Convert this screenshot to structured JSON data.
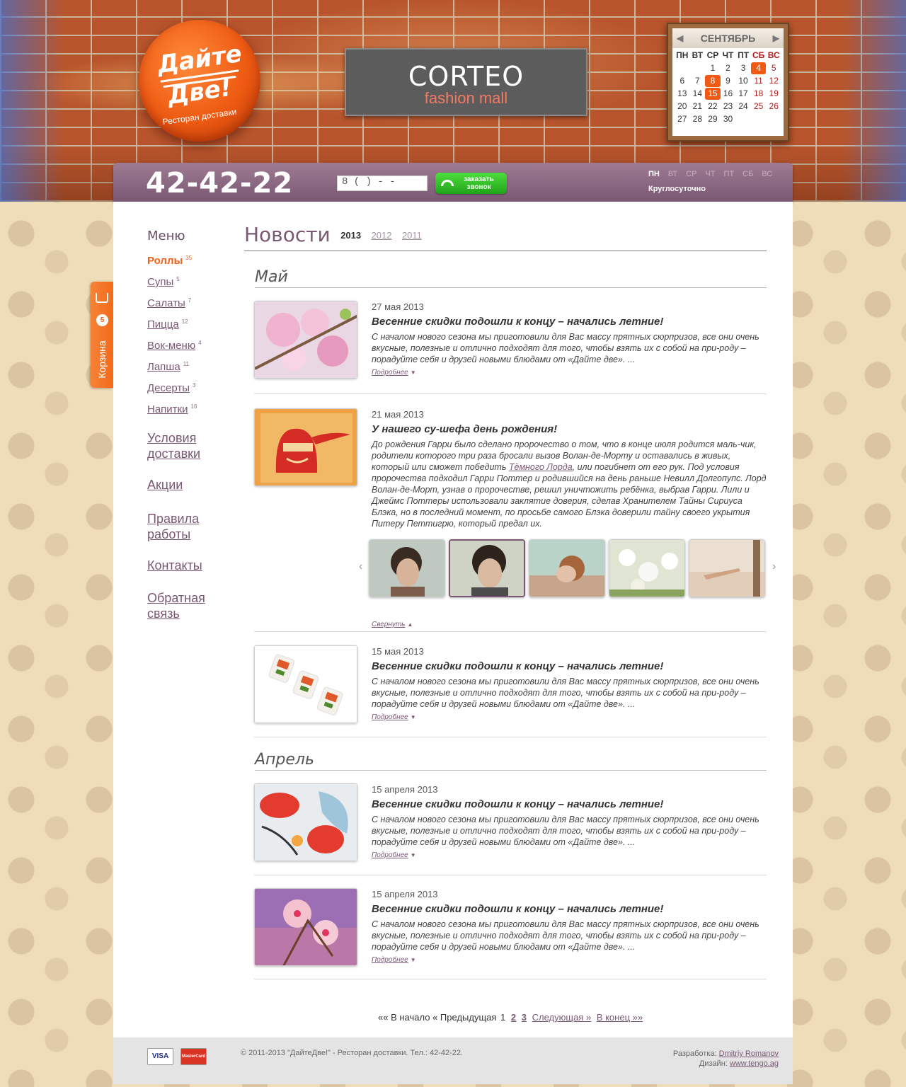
{
  "header": {
    "logo_line1": "Дайте",
    "logo_line2": "Две!",
    "logo_sub": "Ресторан доставки",
    "banner_title": "CORTEO",
    "banner_sub": "fashion mall",
    "calendar": {
      "month": "СЕНТЯБРЬ",
      "prev": "◀",
      "next": "▶",
      "day_names": [
        "ПН",
        "ВТ",
        "СР",
        "ЧТ",
        "ПТ",
        "СБ",
        "ВС"
      ],
      "weeks": [
        [
          "",
          "",
          "1",
          "2",
          "3",
          "4",
          "5"
        ],
        [
          "6",
          "7",
          "8",
          "9",
          "10",
          "11",
          "12"
        ],
        [
          "13",
          "14",
          "15",
          "16",
          "17",
          "18",
          "19"
        ],
        [
          "20",
          "21",
          "22",
          "23",
          "24",
          "25",
          "26"
        ],
        [
          "27",
          "28",
          "29",
          "30",
          "",
          "",
          ""
        ]
      ],
      "highlighted": [
        "4",
        "8",
        "15"
      ]
    }
  },
  "topbar": {
    "phone": "42-42-22",
    "phone_input_value": "8 (    )       -   -",
    "call_button": [
      "заказать",
      "звонок"
    ],
    "days": [
      "ПН",
      "ВТ",
      "СР",
      "ЧТ",
      "ПТ",
      "СБ",
      "ВС"
    ],
    "active_day": "ПН",
    "hours": "Круглосуточно"
  },
  "cart": {
    "label": "Корзина",
    "count": "5"
  },
  "menu": {
    "title": "Меню",
    "items": [
      {
        "label": "Роллы",
        "count": "35",
        "active": true
      },
      {
        "label": "Супы",
        "count": "5"
      },
      {
        "label": "Салаты",
        "count": "7"
      },
      {
        "label": "Пицца",
        "count": "12"
      },
      {
        "label": "Вок-меню",
        "count": "4"
      },
      {
        "label": "Лапша",
        "count": "11"
      },
      {
        "label": "Десерты",
        "count": "3"
      },
      {
        "label": "Напитки",
        "count": "16"
      }
    ],
    "links": [
      [
        "Условия",
        "доставки"
      ],
      [
        "Акции"
      ],
      [
        "Правила",
        "работы"
      ],
      [
        "Контакты"
      ],
      [
        "Обратная",
        "связь"
      ]
    ]
  },
  "news": {
    "title": "Новости",
    "years": [
      "2013",
      "2012",
      "2011"
    ],
    "months": [
      "Май",
      "Апрель"
    ],
    "items": [
      {
        "date": "27 мая 2013",
        "title": "Весенние скидки подошли к концу – начались летние!",
        "text": "С началом нового сезона мы приготовили для Вас массу прятных сюрпризов, все они очень вкусные, полезные и отлично подходят для того, чтобы взять их с собой на при-роду – порадуйте себя и друзей новыми блюдами от «Дайте две». ...",
        "more": "Подробнее"
      },
      {
        "date": "21 мая 2013",
        "title": "У нашего су-шефа день рождения!",
        "text_before": "До рождения Гарри было сделано пророчество о том, что в конце июля родится маль-чик, родители которого три раза бросали вызов Волан-де-Морту и оставались в живых, который или сможет победить ",
        "link": "Тёмного Лорда",
        "text_after": ", или погибнет от его рук. Под условия пророчества подходил Гарри Поттер и родившийся на день раньше Невилл Долгопупс. Лорд Волан-де-Морт, узнав о пророчестве, решил уничтожить ребёнка, выбрав Гарри. Лили и Джеймс Поттеры использовали заклятие доверия, сделав Хранителем Тайны Сириуса Блэка, но в последний момент, по просьбе самого Блэка доверили тайну своего укрытия Питеру Петтигрю, который предал их.",
        "collapse": "Свернуть"
      },
      {
        "date": "15 мая 2013",
        "title": "Весенние скидки подошли к концу – начались летние!",
        "text": "С началом нового сезона мы приготовили для Вас массу прятных сюрпризов, все они очень вкусные, полезные и отлично подходят для того, чтобы взять их с собой на при-роду – порадуйте себя и друзей новыми блюдами от «Дайте две». ...",
        "more": "Подробнее"
      },
      {
        "date": "15 апреля 2013",
        "title": "Весенние скидки подошли к концу – начались летние!",
        "text": "С началом нового сезона мы приготовили для Вас массу прятных сюрпризов, все они очень вкусные, полезные и отлично подходят для того, чтобы взять их с собой на при-роду – порадуйте себя и друзей новыми блюдами от «Дайте две». ...",
        "more": "Подробнее"
      },
      {
        "date": "15 апреля 2013",
        "title": "Весенние скидки подошли к концу – начались летние!",
        "text": "С началом нового сезона мы приготовили для Вас массу прятных сюрпризов, все они очень вкусные, полезные и отлично подходят для того, чтобы взять их с собой на при-роду – порадуйте себя и друзей новыми блюдами от «Дайте две». ...",
        "more": "Подробнее"
      }
    ]
  },
  "pager": {
    "first": "«« В начало",
    "prev": "« Предыдущая",
    "pages": [
      "1",
      "2",
      "3"
    ],
    "current": "1",
    "next": "Следующая »",
    "last": "В конец »»"
  },
  "footer": {
    "cards": [
      "VISA",
      "MasterCard"
    ],
    "copyright": "© 2011-2013 \"ДайтеДве!\" - Ресторан доставки.  Тел.: 42-42-22.",
    "dev_label": "Разработка:",
    "dev_name": "Dmitriy Romanov",
    "design_label": "Дизайн:",
    "design_name": "www.tengo.ag"
  }
}
